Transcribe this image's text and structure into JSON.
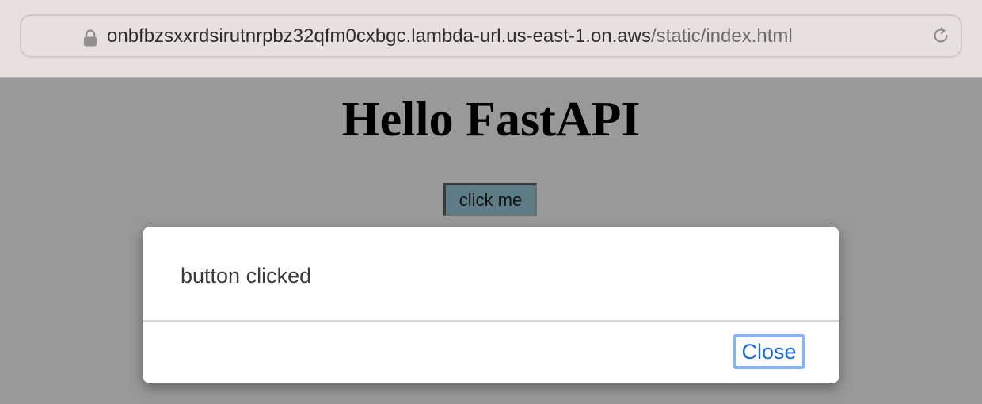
{
  "browser": {
    "url_host": "onbfbzsxxrdsirutnrpbz32qfm0cxbgc.lambda-url.us-east-1.on.aws",
    "url_path": "/static/index.html",
    "lock_icon": "lock-icon",
    "reload_icon": "reload-icon"
  },
  "page": {
    "title": "Hello FastAPI",
    "button_label": "click me",
    "background_color": "#999999",
    "button_color": "#5d7c85"
  },
  "dialog": {
    "message": "button clicked",
    "close_label": "Close",
    "close_color": "#1a6ad9",
    "focus_ring_color": "#8ab2f5"
  }
}
